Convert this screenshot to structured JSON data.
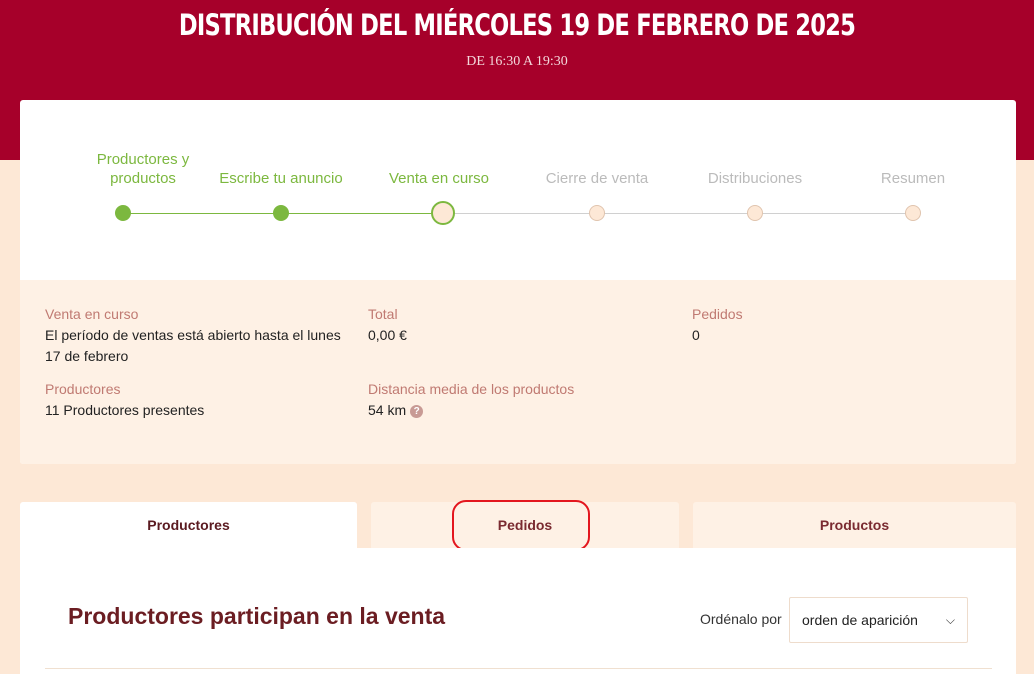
{
  "header": {
    "title": "DISTRIBUCIÓN DEL MIÉRCOLES 19 DE FEBRERO DE 2025",
    "subtitle": "DE 16:30 A 19:30"
  },
  "steps": [
    {
      "label": "Productores y productos",
      "state": "done"
    },
    {
      "label": "Escribe tu anuncio",
      "state": "done"
    },
    {
      "label": "Venta en curso",
      "state": "current"
    },
    {
      "label": "Cierre de venta",
      "state": "todo"
    },
    {
      "label": "Distribuciones",
      "state": "todo"
    },
    {
      "label": "Resumen",
      "state": "todo"
    }
  ],
  "summary": {
    "sale_label": "Venta en curso",
    "sale_value": "El período de ventas está abierto hasta el lunes 17 de febrero",
    "total_label": "Total",
    "total_value": "0,00 €",
    "orders_label": "Pedidos",
    "orders_value": "0",
    "producers_label": "Productores",
    "producers_value": "11 Productores presentes",
    "distance_label": "Distancia media de los productos",
    "distance_value": "54 km",
    "help_glyph": "?"
  },
  "tabs": [
    {
      "label": "Productores",
      "active": true
    },
    {
      "label": "Pedidos",
      "active": false,
      "highlighted": true
    },
    {
      "label": "Productos",
      "active": false
    }
  ],
  "panel": {
    "title": "Productores participan en la venta",
    "sort_label": "Ordénalo por",
    "sort_value": "orden de aparición",
    "sort_chevron": "⌵"
  },
  "colors": {
    "brand": "#a6002a",
    "accent_green": "#7cb83f",
    "background": "#fde8d6",
    "highlight": "#e3161e"
  }
}
